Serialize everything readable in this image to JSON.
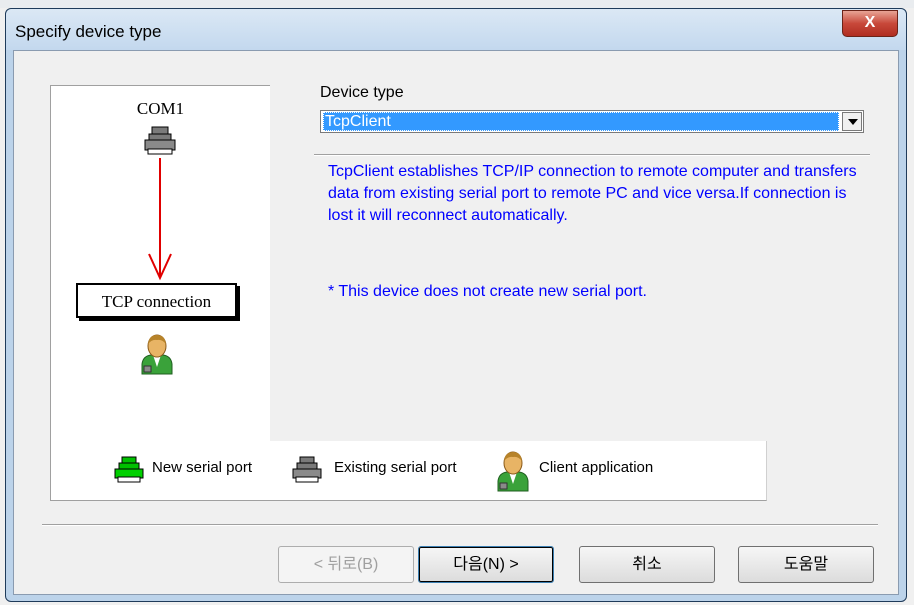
{
  "dialog": {
    "title": "Specify device type",
    "close_label": "X"
  },
  "diagram": {
    "port_label": "COM1",
    "connection_label": "TCP connection",
    "icons": [
      "serial-port-icon",
      "arrow-down",
      "client-application-icon"
    ]
  },
  "device_type": {
    "label": "Device type",
    "selected": "TcpClient"
  },
  "description": "TcpClient establishes TCP/IP connection to remote computer and transfers data from existing serial port to remote PC and vice versa.If connection is lost it will reconnect automatically.",
  "note": "* This device does not create new serial port.",
  "legend": {
    "new_port": "New serial port",
    "existing_port": "Existing serial port",
    "client_app": "Client application"
  },
  "buttons": {
    "back": "< 뒤로(B)",
    "next": "다음(N) >",
    "cancel": "취소",
    "help": "도움말"
  },
  "colors": {
    "new_port": "#00c000",
    "existing_port": "#7a7a7a",
    "arrow": "#e00000",
    "description_text": "#0000ff",
    "selection": "#3399ff"
  }
}
